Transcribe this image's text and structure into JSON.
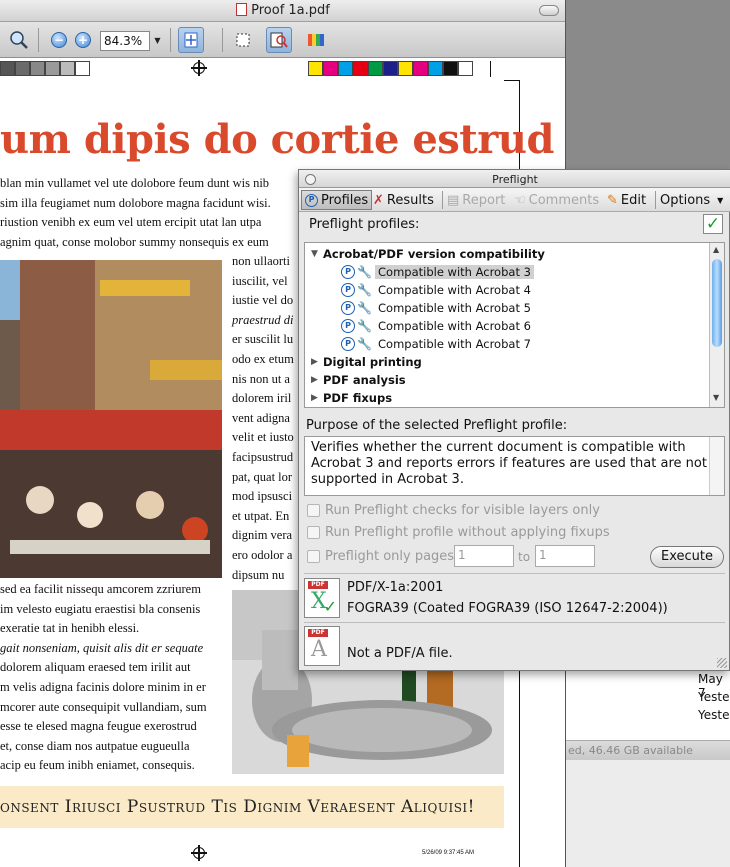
{
  "pdf_window": {
    "title": "Proof 1a.pdf",
    "zoom": "84.3%"
  },
  "document": {
    "headline": "um dipis do cortie estrud",
    "intro_lines": [
      "blan min vullamet vel ute dolobore feum dunt wis nib",
      "sim illa feugiamet num dolobore magna facidunt wisi.",
      "riustion venibh ex eum vel utem ercipit utat lan utpa",
      "agnim quat, conse molobor summy nonsequis ex eum"
    ],
    "right_col_lines": [
      "non ullaorti",
      "iuscilit, vel",
      "iustie vel do",
      "praestrud di",
      "er suscilit lu",
      "odo ex etum",
      "nis non ut a",
      "dolorem iril",
      "vent adigna",
      "velit et iusto",
      "facipsustrud",
      "pat, quat lor",
      "mod ipsusci",
      "et utpat. En",
      "dignim vera",
      "ero odolor a",
      "dipsum nu"
    ],
    "lower_lines": [
      "sed ea facilit nissequ amcorem zzriurem",
      "im velesto eugiatu eraestisi bla consenis",
      "exeratie tat in henibh elessi.",
      "gait nonseniam, quisit alis dit er sequate",
      " dolorem aliquam eraesed tem irilit aut",
      "m velis adigna facinis dolore minim in er",
      "mcorer aute consequipit vullandiam, sum",
      "esse te elesed magna feugue exerostrud",
      "et, conse diam nos autpatue eugueulla",
      " acip eu feum inibh eniamet, consequis."
    ],
    "banner": "onsent Iriusci Psustrud Tis Dignim Veraesent Aliquisi!",
    "footer_timestamp": "5/26/09   9:37:45 AM"
  },
  "finder": {
    "rows": [
      "May 7",
      "Yeste",
      "Yeste"
    ],
    "status": "ed, 46.46 GB available"
  },
  "preflight": {
    "title": "Preflight",
    "tabs": {
      "profiles": "Profiles",
      "results": "Results",
      "report": "Report",
      "comments": "Comments",
      "edit": "Edit",
      "options": "Options"
    },
    "profiles_label": "Preflight profiles:",
    "tree": {
      "group1": "Acrobat/PDF version compatibility",
      "children": [
        "Compatible with Acrobat 3",
        "Compatible with Acrobat 4",
        "Compatible with Acrobat 5",
        "Compatible with Acrobat 6",
        "Compatible with Acrobat 7"
      ],
      "group2": "Digital printing",
      "group3": "PDF analysis",
      "group4": "PDF fixups"
    },
    "purpose_label": "Purpose of the selected Preflight profile:",
    "purpose_text": "Verifies whether the current document is compatible with Acrobat 3 and reports errors if features are used that are not supported in Acrobat 3.",
    "opt_visible_layers": "Run Preflight checks for visible layers only",
    "opt_no_fixups": "Run Preflight profile without applying fixups",
    "opt_only_pages": "Preflight only pages",
    "page_from": "1",
    "page_to_label": "to",
    "page_to": "1",
    "execute": "Execute",
    "pdfx_line1": "PDF/X-1a:2001",
    "pdfx_line2": "FOGRA39 (Coated FOGRA39 (ISO 12647-2:2004))",
    "pdfa_status": "Not a PDF/A file.",
    "icon_tag": "PDF",
    "pdfx_letter": "X",
    "pdfa_letter": "A"
  }
}
